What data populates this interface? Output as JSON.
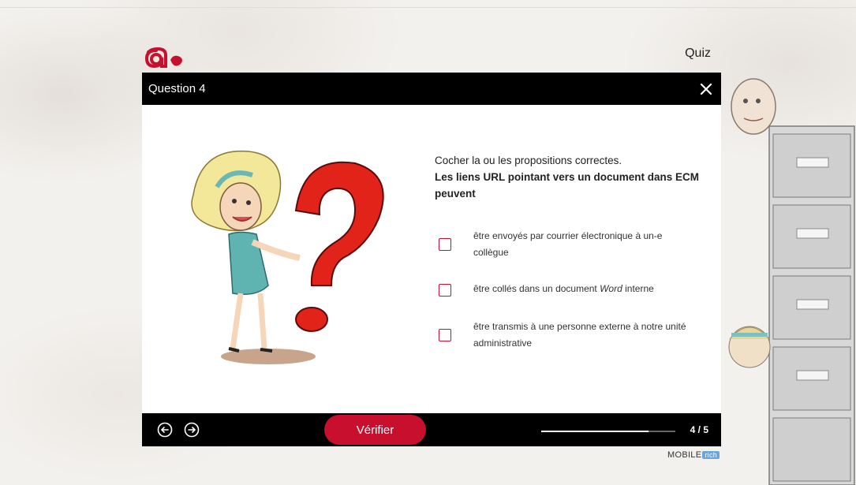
{
  "header": {
    "app_label": "Quiz"
  },
  "question": {
    "title": "Question 4",
    "instruction": "Cocher la ou les propositions correctes.",
    "text": "Les liens URL pointant vers un document dans ECM peuvent"
  },
  "options": [
    {
      "text": "être envoyés par courrier électronique à un-e collègue",
      "checked": false
    },
    {
      "text_before": "être collés dans un document ",
      "text_italic": "Word",
      "text_after": " interne",
      "checked": false
    },
    {
      "text": "être transmis à une personne externe à notre unité administrative",
      "checked": false
    }
  ],
  "footer": {
    "verify_label": "Vérifier",
    "progress_text": "4 / 5",
    "progress_fraction": 0.8
  },
  "brand": {
    "name": "MOBILE",
    "badge": "rich"
  },
  "colors": {
    "accent": "#c8102e",
    "bar": "#000000",
    "surface": "#ffffff"
  },
  "icons": {
    "close": "close-icon",
    "prev": "arrow-left-circle-icon",
    "next": "arrow-right-circle-icon",
    "logo": "logo-icon"
  }
}
